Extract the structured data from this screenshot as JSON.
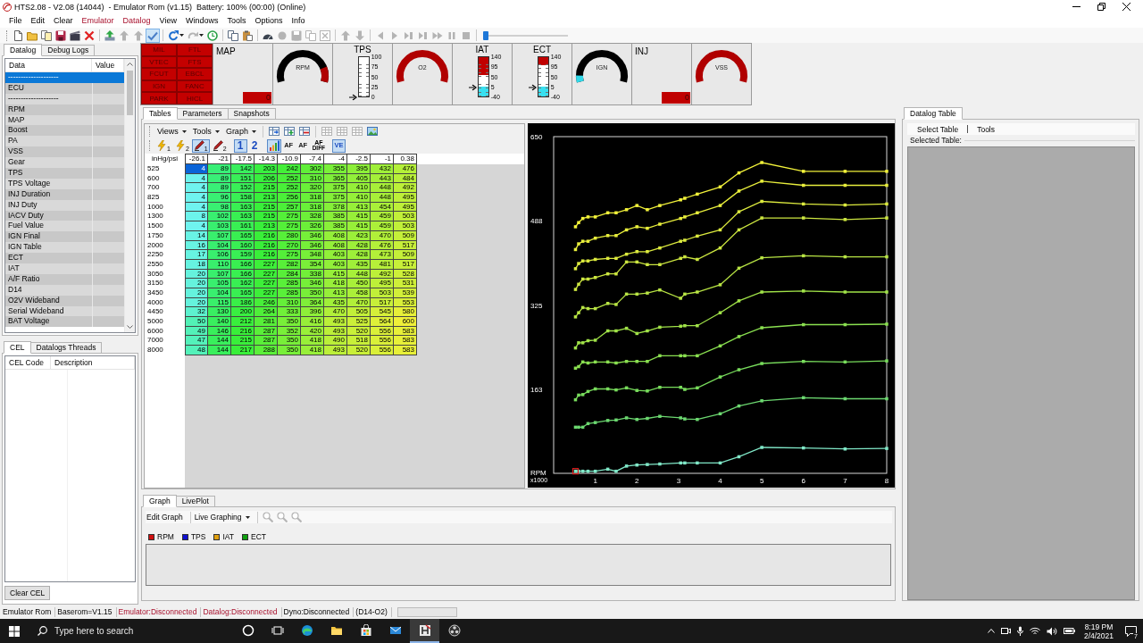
{
  "window": {
    "title": "HTS2.08 - V2.08 (14044)  - Emulator Rom (v1.15)  Battery: 100% (00:00) (Online)"
  },
  "menu": [
    {
      "label": "File",
      "alert": false
    },
    {
      "label": "Edit",
      "alert": false
    },
    {
      "label": "Clear",
      "alert": false
    },
    {
      "label": "Emulator",
      "alert": true
    },
    {
      "label": "Datalog",
      "alert": true
    },
    {
      "label": "View",
      "alert": false
    },
    {
      "label": "Windows",
      "alert": false
    },
    {
      "label": "Tools",
      "alert": false
    },
    {
      "label": "Options",
      "alert": false
    },
    {
      "label": "Info",
      "alert": false
    }
  ],
  "toolbar": {
    "groups": [
      {
        "buttons": [
          {
            "kind": "new",
            "disabled": false,
            "pressed": false,
            "dropdown": false
          },
          {
            "kind": "open",
            "disabled": false,
            "pressed": false,
            "dropdown": false
          },
          {
            "kind": "template",
            "disabled": false,
            "pressed": false,
            "dropdown": false
          },
          {
            "kind": "save",
            "disabled": false,
            "pressed": false,
            "dropdown": false
          },
          {
            "kind": "film",
            "disabled": false,
            "pressed": false,
            "dropdown": false
          },
          {
            "kind": "delete",
            "disabled": false,
            "pressed": false,
            "dropdown": false
          }
        ]
      },
      {
        "buttons": [
          {
            "kind": "upload",
            "disabled": false,
            "pressed": false,
            "dropdown": false
          },
          {
            "kind": "up",
            "disabled": true,
            "pressed": false,
            "dropdown": false
          },
          {
            "kind": "up",
            "disabled": true,
            "pressed": false,
            "dropdown": false
          },
          {
            "kind": "check",
            "disabled": false,
            "pressed": true,
            "dropdown": false
          }
        ]
      },
      {
        "buttons": [
          {
            "kind": "refresh",
            "disabled": false,
            "pressed": false,
            "dropdown": true
          },
          {
            "kind": "redo",
            "disabled": true,
            "pressed": false,
            "dropdown": true
          },
          {
            "kind": "clock",
            "disabled": false,
            "pressed": false,
            "dropdown": false
          }
        ]
      },
      {
        "buttons": [
          {
            "kind": "copy",
            "disabled": false,
            "pressed": false,
            "dropdown": false
          },
          {
            "kind": "paste",
            "disabled": false,
            "pressed": false,
            "dropdown": false
          }
        ]
      },
      {
        "buttons": [
          {
            "kind": "gauge",
            "disabled": false,
            "pressed": false,
            "dropdown": false
          },
          {
            "kind": "record",
            "disabled": true,
            "pressed": false,
            "dropdown": false
          },
          {
            "kind": "save",
            "disabled": true,
            "pressed": false,
            "dropdown": false
          },
          {
            "kind": "copy",
            "disabled": true,
            "pressed": false,
            "dropdown": false
          },
          {
            "kind": "close",
            "disabled": true,
            "pressed": false,
            "dropdown": false
          }
        ]
      },
      {
        "buttons": [
          {
            "kind": "up",
            "disabled": true,
            "pressed": false,
            "dropdown": false
          },
          {
            "kind": "down",
            "disabled": true,
            "pressed": false,
            "dropdown": false
          }
        ]
      },
      {
        "buttons": [
          {
            "kind": "prev",
            "disabled": true,
            "pressed": false,
            "dropdown": false
          },
          {
            "kind": "next",
            "disabled": true,
            "pressed": false,
            "dropdown": false
          },
          {
            "kind": "skip",
            "disabled": true,
            "pressed": false,
            "dropdown": false
          },
          {
            "kind": "skip",
            "disabled": true,
            "pressed": false,
            "dropdown": false
          },
          {
            "kind": "forward",
            "disabled": true,
            "pressed": false,
            "dropdown": false
          },
          {
            "kind": "pause",
            "disabled": true,
            "pressed": false,
            "dropdown": false
          },
          {
            "kind": "stop",
            "disabled": true,
            "pressed": false,
            "dropdown": false
          }
        ]
      }
    ],
    "slider": {
      "level": 0
    }
  },
  "gauges": [
    {
      "kind": "lamps",
      "lamps": [
        "MIL",
        "FTL",
        "VTEC",
        "FTS",
        "FCUT",
        "EBCL",
        "IGN",
        "FANC",
        "PARK",
        "HICL"
      ]
    },
    {
      "kind": "readout",
      "label": "MAP",
      "value": "0"
    },
    {
      "kind": "dial",
      "label": "RPM",
      "color": "#000000",
      "start_zone": false,
      "end_zone": true
    },
    {
      "kind": "bar",
      "label": "TPS",
      "ticks": [
        "100",
        "75",
        "50",
        "25",
        "0"
      ],
      "level": 0
    },
    {
      "kind": "dial",
      "label": "O2",
      "color": "#b00000",
      "start_zone": false,
      "end_zone": false
    },
    {
      "kind": "bar",
      "label": "IAT",
      "ticks": [
        "140",
        "95",
        "50",
        "5",
        "-40"
      ],
      "level": 0.25,
      "warning_zone": {
        "level": 0.45
      }
    },
    {
      "kind": "bar",
      "label": "ECT",
      "ticks": [
        "140",
        "95",
        "50",
        "5",
        "-40"
      ],
      "level": 0.25,
      "warning_zone": {
        "level": 0.2
      }
    },
    {
      "kind": "dial",
      "label": "IGN",
      "color": "#000000",
      "start_zone": true,
      "end_zone": false
    },
    {
      "kind": "readout",
      "label": "INJ",
      "value": "0"
    },
    {
      "kind": "dial",
      "label": "VSS",
      "color": "#b00000",
      "start_zone": false,
      "end_zone": false
    }
  ],
  "datalog_panel": {
    "tabs": [
      {
        "label": "Datalog",
        "selected": true
      },
      {
        "label": "Debug Logs",
        "selected": false
      }
    ],
    "columns": [
      "Data",
      "Value"
    ],
    "rows": [
      {
        "label": "--------------------",
        "selected": true
      },
      {
        "label": "ECU",
        "selected": false
      },
      {
        "label": "--------------------",
        "selected": false
      },
      {
        "label": "RPM",
        "selected": false
      },
      {
        "label": "MAP",
        "selected": false
      },
      {
        "label": "Boost",
        "selected": false
      },
      {
        "label": "PA",
        "selected": false
      },
      {
        "label": "VSS",
        "selected": false
      },
      {
        "label": "Gear",
        "selected": false
      },
      {
        "label": "TPS",
        "selected": false
      },
      {
        "label": "TPS Voltage",
        "selected": false
      },
      {
        "label": "INJ Duration",
        "selected": false
      },
      {
        "label": "INJ Duty",
        "selected": false
      },
      {
        "label": "IACV Duty",
        "selected": false
      },
      {
        "label": "Fuel Value",
        "selected": false
      },
      {
        "label": "IGN Final",
        "selected": false
      },
      {
        "label": "IGN Table",
        "selected": false
      },
      {
        "label": "ECT",
        "selected": false
      },
      {
        "label": "IAT",
        "selected": false
      },
      {
        "label": "A/F Ratio",
        "selected": false
      },
      {
        "label": "D14",
        "selected": false
      },
      {
        "label": "O2V Wideband",
        "selected": false
      },
      {
        "label": "Serial Wideband",
        "selected": false
      },
      {
        "label": "BAT Voltage",
        "selected": false
      }
    ]
  },
  "cel_panel": {
    "tabs": [
      {
        "label": "CEL",
        "selected": true
      },
      {
        "label": "Datalogs Threads",
        "selected": false
      }
    ],
    "columns": [
      "CEL Code",
      "Description"
    ],
    "button": "Clear CEL"
  },
  "tables_panel": {
    "tabs": [
      {
        "label": "Tables",
        "selected": true
      },
      {
        "label": "Parameters",
        "selected": false
      },
      {
        "label": "Snapshots",
        "selected": false
      }
    ],
    "menus": [
      {
        "label": "Views"
      },
      {
        "label": "Tools"
      },
      {
        "label": "Graph"
      }
    ],
    "tools": [
      {
        "kind": "tableimport",
        "disabled": false
      },
      {
        "kind": "tableadd",
        "disabled": false
      },
      {
        "kind": "tableremove",
        "disabled": false
      },
      {
        "kind": "grid",
        "disabled": true
      },
      {
        "kind": "grid",
        "disabled": true
      },
      {
        "kind": "grid",
        "disabled": true
      },
      {
        "kind": "image",
        "disabled": false
      }
    ],
    "modes": [
      {
        "kind": "bolt",
        "sub": "1",
        "pressed": false
      },
      {
        "kind": "bolt",
        "sub": "2",
        "pressed": false
      },
      {
        "kind": "pen",
        "sub": "1",
        "pressed": true
      },
      {
        "kind": "pen",
        "sub": "2",
        "pressed": false
      },
      {
        "kind": "text",
        "label": "1",
        "pressed": true
      },
      {
        "kind": "text",
        "label": "2",
        "pressed": false
      },
      {
        "kind": "chart",
        "pressed": true
      },
      {
        "kind": "text",
        "label": "AF",
        "pressed": false
      },
      {
        "kind": "text",
        "label": "AF",
        "pressed": false
      },
      {
        "kind": "stack",
        "label": "AF",
        "sub": "DIFF",
        "pressed": false
      },
      {
        "kind": "text",
        "label": "VE",
        "pressed": true
      }
    ],
    "table": {
      "corner": "inHg/psi",
      "columns": [
        "-26.1",
        "-21",
        "-17.5",
        "-14.3",
        "-10.9",
        "-7.4",
        "-4",
        "-2.5",
        "-1",
        "0.38"
      ],
      "rows": [
        {
          "label": "525",
          "cells": [
            {
              "value": "4",
              "selected": true
            },
            {
              "value": "89",
              "selected": false
            },
            {
              "value": "142",
              "selected": false
            },
            {
              "value": "203",
              "selected": false
            },
            {
              "value": "242",
              "selected": false
            },
            {
              "value": "302",
              "selected": false
            },
            {
              "value": "355",
              "selected": false
            },
            {
              "value": "395",
              "selected": false
            },
            {
              "value": "432",
              "selected": false
            },
            {
              "value": "476",
              "selected": false
            }
          ]
        },
        {
          "label": "600",
          "cells": [
            {
              "value": "4",
              "selected": false
            },
            {
              "value": "89",
              "selected": false
            },
            {
              "value": "151",
              "selected": false
            },
            {
              "value": "206",
              "selected": false
            },
            {
              "value": "252",
              "selected": false
            },
            {
              "value": "310",
              "selected": false
            },
            {
              "value": "365",
              "selected": false
            },
            {
              "value": "405",
              "selected": false
            },
            {
              "value": "443",
              "selected": false
            },
            {
              "value": "484",
              "selected": false
            }
          ]
        },
        {
          "label": "700",
          "cells": [
            {
              "value": "4",
              "selected": false
            },
            {
              "value": "89",
              "selected": false
            },
            {
              "value": "152",
              "selected": false
            },
            {
              "value": "215",
              "selected": false
            },
            {
              "value": "252",
              "selected": false
            },
            {
              "value": "320",
              "selected": false
            },
            {
              "value": "375",
              "selected": false
            },
            {
              "value": "410",
              "selected": false
            },
            {
              "value": "448",
              "selected": false
            },
            {
              "value": "492",
              "selected": false
            }
          ]
        },
        {
          "label": "825",
          "cells": [
            {
              "value": "4",
              "selected": false
            },
            {
              "value": "96",
              "selected": false
            },
            {
              "value": "158",
              "selected": false
            },
            {
              "value": "213",
              "selected": false
            },
            {
              "value": "256",
              "selected": false
            },
            {
              "value": "318",
              "selected": false
            },
            {
              "value": "375",
              "selected": false
            },
            {
              "value": "410",
              "selected": false
            },
            {
              "value": "448",
              "selected": false
            },
            {
              "value": "495",
              "selected": false
            }
          ]
        },
        {
          "label": "1000",
          "cells": [
            {
              "value": "4",
              "selected": false
            },
            {
              "value": "98",
              "selected": false
            },
            {
              "value": "163",
              "selected": false
            },
            {
              "value": "215",
              "selected": false
            },
            {
              "value": "257",
              "selected": false
            },
            {
              "value": "318",
              "selected": false
            },
            {
              "value": "378",
              "selected": false
            },
            {
              "value": "413",
              "selected": false
            },
            {
              "value": "454",
              "selected": false
            },
            {
              "value": "495",
              "selected": false
            }
          ]
        },
        {
          "label": "1300",
          "cells": [
            {
              "value": "8",
              "selected": false
            },
            {
              "value": "102",
              "selected": false
            },
            {
              "value": "163",
              "selected": false
            },
            {
              "value": "215",
              "selected": false
            },
            {
              "value": "275",
              "selected": false
            },
            {
              "value": "328",
              "selected": false
            },
            {
              "value": "385",
              "selected": false
            },
            {
              "value": "415",
              "selected": false
            },
            {
              "value": "459",
              "selected": false
            },
            {
              "value": "503",
              "selected": false
            }
          ]
        },
        {
          "label": "1500",
          "cells": [
            {
              "value": "4",
              "selected": false
            },
            {
              "value": "103",
              "selected": false
            },
            {
              "value": "161",
              "selected": false
            },
            {
              "value": "213",
              "selected": false
            },
            {
              "value": "275",
              "selected": false
            },
            {
              "value": "326",
              "selected": false
            },
            {
              "value": "385",
              "selected": false
            },
            {
              "value": "415",
              "selected": false
            },
            {
              "value": "459",
              "selected": false
            },
            {
              "value": "503",
              "selected": false
            }
          ]
        },
        {
          "label": "1750",
          "cells": [
            {
              "value": "14",
              "selected": false
            },
            {
              "value": "107",
              "selected": false
            },
            {
              "value": "165",
              "selected": false
            },
            {
              "value": "216",
              "selected": false
            },
            {
              "value": "280",
              "selected": false
            },
            {
              "value": "346",
              "selected": false
            },
            {
              "value": "408",
              "selected": false
            },
            {
              "value": "423",
              "selected": false
            },
            {
              "value": "470",
              "selected": false
            },
            {
              "value": "509",
              "selected": false
            }
          ]
        },
        {
          "label": "2000",
          "cells": [
            {
              "value": "16",
              "selected": false
            },
            {
              "value": "104",
              "selected": false
            },
            {
              "value": "160",
              "selected": false
            },
            {
              "value": "216",
              "selected": false
            },
            {
              "value": "270",
              "selected": false
            },
            {
              "value": "346",
              "selected": false
            },
            {
              "value": "408",
              "selected": false
            },
            {
              "value": "428",
              "selected": false
            },
            {
              "value": "476",
              "selected": false
            },
            {
              "value": "517",
              "selected": false
            }
          ]
        },
        {
          "label": "2250",
          "cells": [
            {
              "value": "17",
              "selected": false
            },
            {
              "value": "106",
              "selected": false
            },
            {
              "value": "159",
              "selected": false
            },
            {
              "value": "216",
              "selected": false
            },
            {
              "value": "275",
              "selected": false
            },
            {
              "value": "348",
              "selected": false
            },
            {
              "value": "403",
              "selected": false
            },
            {
              "value": "428",
              "selected": false
            },
            {
              "value": "473",
              "selected": false
            },
            {
              "value": "509",
              "selected": false
            }
          ]
        },
        {
          "label": "2550",
          "cells": [
            {
              "value": "18",
              "selected": false
            },
            {
              "value": "110",
              "selected": false
            },
            {
              "value": "166",
              "selected": false
            },
            {
              "value": "227",
              "selected": false
            },
            {
              "value": "282",
              "selected": false
            },
            {
              "value": "354",
              "selected": false
            },
            {
              "value": "403",
              "selected": false
            },
            {
              "value": "435",
              "selected": false
            },
            {
              "value": "481",
              "selected": false
            },
            {
              "value": "517",
              "selected": false
            }
          ]
        },
        {
          "label": "3050",
          "cells": [
            {
              "value": "20",
              "selected": false
            },
            {
              "value": "107",
              "selected": false
            },
            {
              "value": "166",
              "selected": false
            },
            {
              "value": "227",
              "selected": false
            },
            {
              "value": "284",
              "selected": false
            },
            {
              "value": "338",
              "selected": false
            },
            {
              "value": "415",
              "selected": false
            },
            {
              "value": "448",
              "selected": false
            },
            {
              "value": "492",
              "selected": false
            },
            {
              "value": "528",
              "selected": false
            }
          ]
        },
        {
          "label": "3150",
          "cells": [
            {
              "value": "20",
              "selected": false
            },
            {
              "value": "105",
              "selected": false
            },
            {
              "value": "162",
              "selected": false
            },
            {
              "value": "227",
              "selected": false
            },
            {
              "value": "285",
              "selected": false
            },
            {
              "value": "346",
              "selected": false
            },
            {
              "value": "418",
              "selected": false
            },
            {
              "value": "450",
              "selected": false
            },
            {
              "value": "495",
              "selected": false
            },
            {
              "value": "531",
              "selected": false
            }
          ]
        },
        {
          "label": "3450",
          "cells": [
            {
              "value": "20",
              "selected": false
            },
            {
              "value": "104",
              "selected": false
            },
            {
              "value": "165",
              "selected": false
            },
            {
              "value": "227",
              "selected": false
            },
            {
              "value": "285",
              "selected": false
            },
            {
              "value": "350",
              "selected": false
            },
            {
              "value": "413",
              "selected": false
            },
            {
              "value": "458",
              "selected": false
            },
            {
              "value": "503",
              "selected": false
            },
            {
              "value": "539",
              "selected": false
            }
          ]
        },
        {
          "label": "4000",
          "cells": [
            {
              "value": "20",
              "selected": false
            },
            {
              "value": "115",
              "selected": false
            },
            {
              "value": "186",
              "selected": false
            },
            {
              "value": "246",
              "selected": false
            },
            {
              "value": "310",
              "selected": false
            },
            {
              "value": "364",
              "selected": false
            },
            {
              "value": "435",
              "selected": false
            },
            {
              "value": "470",
              "selected": false
            },
            {
              "value": "517",
              "selected": false
            },
            {
              "value": "553",
              "selected": false
            }
          ]
        },
        {
          "label": "4450",
          "cells": [
            {
              "value": "32",
              "selected": false
            },
            {
              "value": "130",
              "selected": false
            },
            {
              "value": "200",
              "selected": false
            },
            {
              "value": "264",
              "selected": false
            },
            {
              "value": "333",
              "selected": false
            },
            {
              "value": "396",
              "selected": false
            },
            {
              "value": "470",
              "selected": false
            },
            {
              "value": "505",
              "selected": false
            },
            {
              "value": "545",
              "selected": false
            },
            {
              "value": "580",
              "selected": false
            }
          ]
        },
        {
          "label": "5000",
          "cells": [
            {
              "value": "50",
              "selected": false
            },
            {
              "value": "140",
              "selected": false
            },
            {
              "value": "212",
              "selected": false
            },
            {
              "value": "281",
              "selected": false
            },
            {
              "value": "350",
              "selected": false
            },
            {
              "value": "416",
              "selected": false
            },
            {
              "value": "493",
              "selected": false
            },
            {
              "value": "525",
              "selected": false
            },
            {
              "value": "564",
              "selected": false
            },
            {
              "value": "600",
              "selected": false
            }
          ]
        },
        {
          "label": "6000",
          "cells": [
            {
              "value": "49",
              "selected": false
            },
            {
              "value": "146",
              "selected": false
            },
            {
              "value": "216",
              "selected": false
            },
            {
              "value": "287",
              "selected": false
            },
            {
              "value": "352",
              "selected": false
            },
            {
              "value": "420",
              "selected": false
            },
            {
              "value": "493",
              "selected": false
            },
            {
              "value": "520",
              "selected": false
            },
            {
              "value": "556",
              "selected": false
            },
            {
              "value": "583",
              "selected": false
            }
          ]
        },
        {
          "label": "7000",
          "cells": [
            {
              "value": "47",
              "selected": false
            },
            {
              "value": "144",
              "selected": false
            },
            {
              "value": "215",
              "selected": false
            },
            {
              "value": "287",
              "selected": false
            },
            {
              "value": "350",
              "selected": false
            },
            {
              "value": "418",
              "selected": false
            },
            {
              "value": "490",
              "selected": false
            },
            {
              "value": "518",
              "selected": false
            },
            {
              "value": "556",
              "selected": false
            },
            {
              "value": "583",
              "selected": false
            }
          ]
        },
        {
          "label": "8000",
          "cells": [
            {
              "value": "48",
              "selected": false
            },
            {
              "value": "144",
              "selected": false
            },
            {
              "value": "217",
              "selected": false
            },
            {
              "value": "288",
              "selected": false
            },
            {
              "value": "350",
              "selected": false
            },
            {
              "value": "418",
              "selected": false
            },
            {
              "value": "493",
              "selected": false
            },
            {
              "value": "520",
              "selected": false
            },
            {
              "value": "556",
              "selected": false
            },
            {
              "value": "583",
              "selected": false
            }
          ]
        }
      ]
    },
    "chart_data": {
      "type": "line",
      "xlabel": "RPM",
      "annotations": [
        "x1000"
      ],
      "marker": "square",
      "x": [
        0.525,
        0.6,
        0.7,
        0.825,
        1,
        1.3,
        1.5,
        1.75,
        2,
        2.25,
        2.55,
        3.05,
        3.15,
        3.45,
        4,
        4.45,
        5,
        6,
        7,
        8
      ],
      "xlim": [
        0,
        8
      ],
      "ylim": [
        0,
        650
      ],
      "xticks": [
        1,
        2,
        3,
        4,
        5,
        6,
        7,
        8
      ],
      "yticks": [
        {
          "value": 162.5,
          "label": "163"
        },
        325,
        {
          "value": 487.5,
          "label": "488"
        },
        650
      ],
      "series": [
        {
          "color": "#80e8c8",
          "values": [
            4,
            4,
            4,
            4,
            4,
            8,
            4,
            14,
            16,
            17,
            18,
            20,
            20,
            20,
            20,
            32,
            50,
            49,
            47,
            48
          ]
        },
        {
          "color": "#6cd870",
          "values": [
            89,
            89,
            89,
            96,
            98,
            102,
            103,
            107,
            104,
            106,
            110,
            107,
            105,
            104,
            115,
            130,
            140,
            146,
            144,
            144
          ]
        },
        {
          "color": "#78dc5c",
          "values": [
            142,
            151,
            152,
            158,
            163,
            163,
            161,
            165,
            160,
            159,
            166,
            166,
            162,
            165,
            186,
            200,
            212,
            216,
            215,
            217
          ]
        },
        {
          "color": "#8ae050",
          "values": [
            203,
            206,
            215,
            213,
            215,
            215,
            213,
            216,
            216,
            216,
            227,
            227,
            227,
            227,
            246,
            264,
            281,
            287,
            287,
            288
          ]
        },
        {
          "color": "#a0e248",
          "values": [
            242,
            252,
            252,
            256,
            257,
            275,
            275,
            280,
            270,
            275,
            282,
            284,
            285,
            285,
            310,
            333,
            350,
            352,
            350,
            350
          ]
        },
        {
          "color": "#b8e444",
          "values": [
            302,
            310,
            320,
            318,
            318,
            328,
            326,
            346,
            346,
            348,
            354,
            338,
            346,
            350,
            364,
            396,
            416,
            420,
            418,
            418
          ]
        },
        {
          "color": "#cce640",
          "values": [
            355,
            365,
            375,
            375,
            378,
            385,
            385,
            408,
            408,
            403,
            403,
            415,
            418,
            413,
            435,
            470,
            493,
            493,
            490,
            493
          ]
        },
        {
          "color": "#dcea3e",
          "values": [
            395,
            405,
            410,
            410,
            413,
            415,
            415,
            423,
            428,
            428,
            435,
            448,
            450,
            458,
            470,
            505,
            525,
            520,
            518,
            520
          ]
        },
        {
          "color": "#e8ee3c",
          "values": [
            432,
            443,
            448,
            448,
            454,
            459,
            459,
            470,
            476,
            473,
            481,
            492,
            495,
            503,
            517,
            545,
            564,
            556,
            556,
            556
          ]
        },
        {
          "color": "#f2f23a",
          "values": [
            476,
            484,
            492,
            495,
            495,
            503,
            503,
            509,
            517,
            509,
            517,
            528,
            531,
            539,
            553,
            580,
            600,
            583,
            583,
            583
          ]
        }
      ]
    }
  },
  "graph_panel": {
    "tabs": [
      {
        "label": "Graph",
        "selected": true
      },
      {
        "label": "LivePlot",
        "selected": false
      }
    ],
    "toolbar": [
      {
        "label": "Edit Graph",
        "dropdown": false
      },
      {
        "label": "Live Graphing",
        "dropdown": true
      }
    ],
    "zoom_tools": [
      {
        "disabled": true
      },
      {
        "disabled": true
      },
      {
        "disabled": true
      }
    ],
    "legend": [
      {
        "label": "RPM",
        "color": "#d01010"
      },
      {
        "label": "TPS",
        "color": "#1010d0"
      },
      {
        "label": "IAT",
        "color": "#e0a010"
      },
      {
        "label": "ECT",
        "color": "#10a010"
      }
    ]
  },
  "datalog_table_panel": {
    "tabs": [
      {
        "label": "Datalog Table",
        "selected": true
      }
    ],
    "menus": [
      {
        "label": "Select Table"
      },
      {
        "label": "Tools"
      }
    ],
    "selected_table_label": "Selected Table:"
  },
  "status_bar": {
    "items": [
      {
        "text": "Emulator Rom",
        "alert": false
      },
      {
        "text": "Baserom=V1.15",
        "alert": false
      },
      {
        "text": "Emulator:Disconnected",
        "alert": true
      },
      {
        "text": "Datalog:Disconnected",
        "alert": true
      },
      {
        "text": "Dyno:Disconnected",
        "alert": false
      },
      {
        "text": "(D14-O2)",
        "alert": false
      }
    ],
    "progress": {
      "level": 0
    }
  },
  "taskbar": {
    "search_placeholder": "Type here to search",
    "apps": [
      {
        "kind": "cortana",
        "active": false
      },
      {
        "kind": "taskview",
        "active": false
      },
      {
        "kind": "edge",
        "active": false
      },
      {
        "kind": "explorer",
        "active": false
      },
      {
        "kind": "store",
        "active": false
      },
      {
        "kind": "mail",
        "active": false
      },
      {
        "kind": "hts",
        "active": true
      },
      {
        "kind": "obs",
        "active": false
      }
    ],
    "time": "8:19 PM",
    "date": "2/4/2021",
    "notifications": "7"
  }
}
